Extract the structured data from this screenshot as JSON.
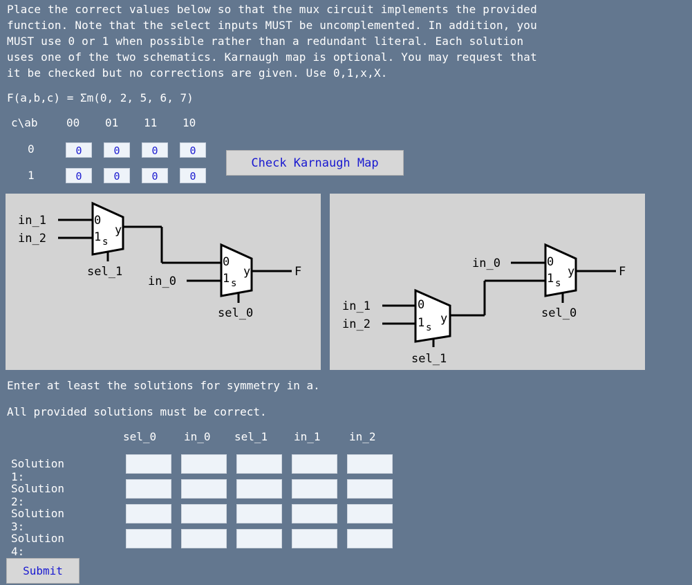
{
  "instructions": {
    "line1": "Place the correct values below so that the mux circuit implements the provided",
    "line2": "function. Note that the select inputs MUST be uncomplemented. In addition, you",
    "line3": "MUST use 0 or 1 when possible rather than a redundant literal. Each solution",
    "line4": "uses one of the two schematics. Karnaugh map is optional. You may request that",
    "line5": "it be checked but no corrections are given. Use 0,1,x,X."
  },
  "function_text": "F(a,b,c) = Σm(0, 2, 5, 6, 7)",
  "kmap": {
    "corner": "c\\ab",
    "col_headers": [
      "00",
      "01",
      "11",
      "10"
    ],
    "row_headers": [
      "0",
      "1"
    ],
    "cells": [
      [
        "0",
        "0",
        "0",
        "0"
      ],
      [
        "0",
        "0",
        "0",
        "0"
      ]
    ],
    "check_button": "Check Karnaugh Map"
  },
  "schematic1": {
    "in_1": "in_1",
    "in_2": "in_2",
    "sel_1": "sel_1",
    "in_0": "in_0",
    "sel_0": "sel_0",
    "out": "F",
    "mux_0": "0",
    "mux_1": "1",
    "mux_s": "s",
    "mux_y": "y"
  },
  "schematic2": {
    "in_1": "in_1",
    "in_2": "in_2",
    "sel_1": "sel_1",
    "in_0": "in_0",
    "sel_0": "sel_0",
    "out": "F",
    "mux_0": "0",
    "mux_1": "1",
    "mux_s": "s",
    "mux_y": "y"
  },
  "notes": {
    "symmetry": "Enter at least the solutions for symmetry in a.",
    "correct": "All provided solutions must be correct."
  },
  "solutions": {
    "headers": [
      "sel_0",
      "in_0",
      "sel_1",
      "in_1",
      "in_2"
    ],
    "rows": [
      {
        "label": "Solution 1:",
        "values": [
          "",
          "",
          "",
          "",
          ""
        ]
      },
      {
        "label": "Solution 2:",
        "values": [
          "",
          "",
          "",
          "",
          ""
        ]
      },
      {
        "label": "Solution 3:",
        "values": [
          "",
          "",
          "",
          "",
          ""
        ]
      },
      {
        "label": "Solution 4:",
        "values": [
          "",
          "",
          "",
          "",
          ""
        ]
      }
    ]
  },
  "submit_button": "Submit",
  "colors": {
    "background": "#63778f",
    "button_text": "#1919d0",
    "panel": "#d3d3d3"
  }
}
